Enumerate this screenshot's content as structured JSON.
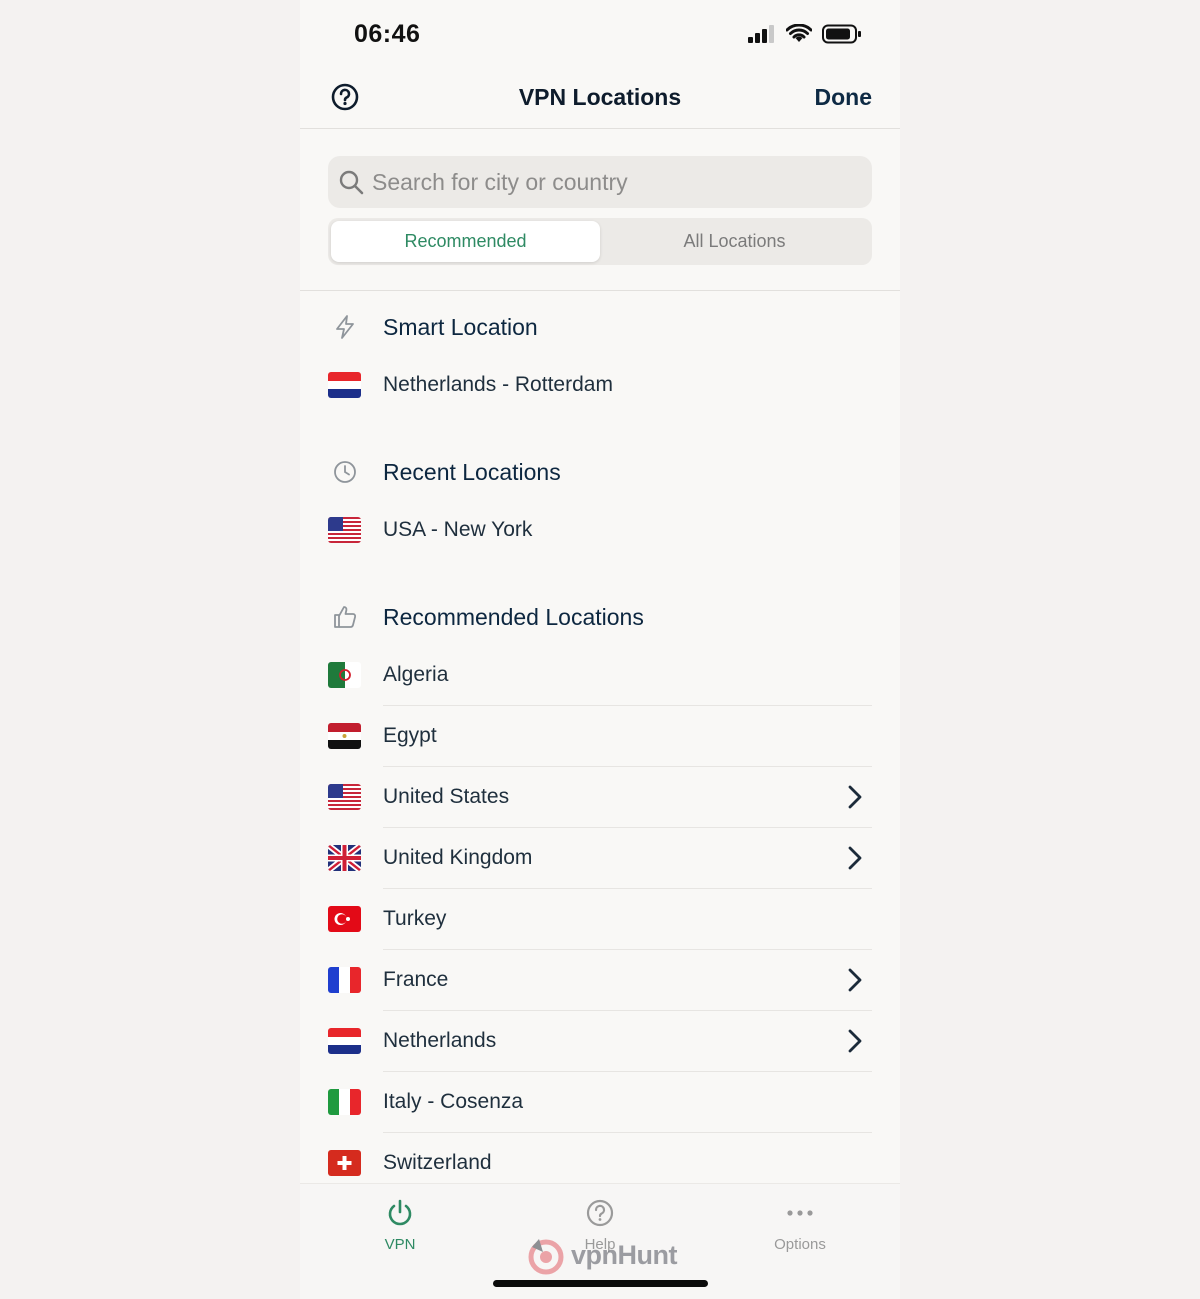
{
  "status": {
    "time": "06:46"
  },
  "nav": {
    "title": "VPN Locations",
    "done": "Done"
  },
  "search": {
    "placeholder": "Search for city or country"
  },
  "tabs": {
    "recommended": "Recommended",
    "all": "All Locations"
  },
  "sections": {
    "smart": {
      "title": "Smart Location",
      "items": [
        "Netherlands - Rotterdam"
      ]
    },
    "recent": {
      "title": "Recent Locations",
      "items": [
        "USA - New York"
      ]
    },
    "recommended": {
      "title": "Recommended Locations",
      "items": [
        "Algeria",
        "Egypt",
        "United States",
        "United Kingdom",
        "Turkey",
        "France",
        "Netherlands",
        "Italy - Cosenza",
        "Switzerland"
      ]
    }
  },
  "tabbar": {
    "vpn": "VPN",
    "help": "Help",
    "options": "Options"
  },
  "watermark": "vpnHunt",
  "colors": {
    "accent": "#2e8a63",
    "heading": "#0d2740",
    "background": "#f9f8f6"
  }
}
